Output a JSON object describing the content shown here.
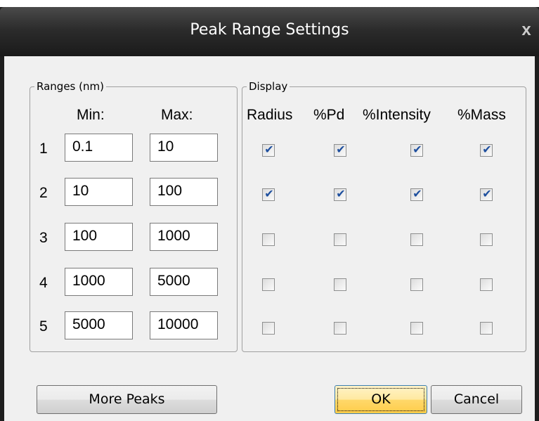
{
  "window": {
    "title": "Peak Range Settings",
    "close_glyph": "x"
  },
  "ranges": {
    "legend": "Ranges (nm)",
    "min_header": "Min:",
    "max_header": "Max:",
    "rows": [
      {
        "index": "1",
        "min": "0.1",
        "max": "10"
      },
      {
        "index": "2",
        "min": "10",
        "max": "100"
      },
      {
        "index": "3",
        "min": "100",
        "max": "1000"
      },
      {
        "index": "4",
        "min": "1000",
        "max": "5000"
      },
      {
        "index": "5",
        "min": "5000",
        "max": "10000"
      }
    ]
  },
  "display": {
    "legend": "Display",
    "headers": [
      "Radius",
      "%Pd",
      "%Intensity",
      "%Mass"
    ],
    "checked": [
      [
        true,
        true,
        true,
        true
      ],
      [
        true,
        true,
        true,
        true
      ],
      [
        false,
        false,
        false,
        false
      ],
      [
        false,
        false,
        false,
        false
      ],
      [
        false,
        false,
        false,
        false
      ]
    ]
  },
  "buttons": {
    "more_peaks": "More Peaks",
    "ok": "OK",
    "cancel": "Cancel"
  },
  "colors": {
    "title_bar": "#2c2c2c",
    "dialog_bg": "#f0f0f0",
    "check_mark": "#1e4f9e",
    "ok_highlight": "#ffd86a"
  },
  "icons": {
    "close": "close-icon",
    "check": "checkmark-icon"
  }
}
